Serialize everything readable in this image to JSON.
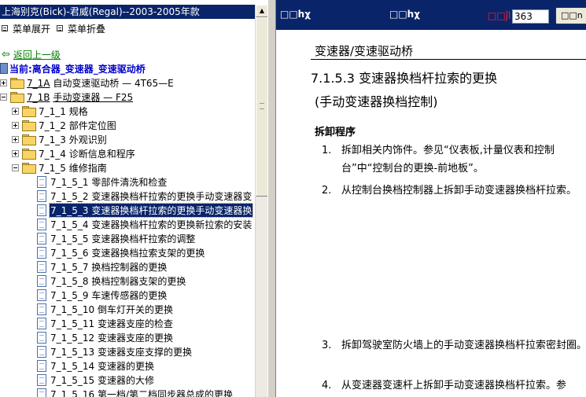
{
  "left": {
    "title": "上海别克(Bick)-君威(Regal)--2003-2005年款",
    "menu_expand": "菜单展开",
    "menu_collapse": "菜单折叠",
    "back_link": "返回上一级",
    "current": "当前:离合器_变速器_变速驱动桥",
    "tree": [
      {
        "code": "7_1A",
        "text": "自动变速驱动桥 — 4T65—E"
      },
      {
        "code": "7_1B",
        "text": "手动变速器 — F25"
      },
      {
        "code": "7_1_1",
        "text": "规格"
      },
      {
        "code": "7_1_2",
        "text": "部件定位图"
      },
      {
        "code": "7_1_3",
        "text": "外观识别"
      },
      {
        "code": "7_1_4",
        "text": "诊断信息和程序"
      },
      {
        "code": "7_1_5",
        "text": "维修指南"
      },
      {
        "code": "7_1_5_1",
        "text": "零部件清洗和检查"
      },
      {
        "code": "7_1_5_2",
        "text": "变速器换档杆拉索的更换手动变速器变"
      },
      {
        "code": "7_1_5_3",
        "text": "变速器换档杆拉索的更换手动变速器换"
      },
      {
        "code": "7_1_5_4",
        "text": "变速器换档杆拉索的更换新拉索的安装"
      },
      {
        "code": "7_1_5_5",
        "text": "变速器换档杆拉索的调整"
      },
      {
        "code": "7_1_5_6",
        "text": "变速器换档拉索支架的更换"
      },
      {
        "code": "7_1_5_7",
        "text": "换档控制器的更换"
      },
      {
        "code": "7_1_5_8",
        "text": "换档控制器支架的更换"
      },
      {
        "code": "7_1_5_9",
        "text": "车速传感器的更换"
      },
      {
        "code": "7_1_5_10",
        "text": "倒车灯开关的更换"
      },
      {
        "code": "7_1_5_11",
        "text": "变速器支座的检查"
      },
      {
        "code": "7_1_5_12",
        "text": "变速器支座的更换"
      },
      {
        "code": "7_1_5_13",
        "text": "变速器支座支撑的更换"
      },
      {
        "code": "7_1_5_14",
        "text": "变速器的更换"
      },
      {
        "code": "7_1_5_15",
        "text": "变速器的大修"
      },
      {
        "code": "7_1_5_16",
        "text": "第一档/第二档同步器总成的更换"
      }
    ]
  },
  "toolbar": {
    "left_text": "□□hχ",
    "mid_text": "□□hχ",
    "label": "□□ĵl",
    "input_value": "363",
    "button": "□□n"
  },
  "doc": {
    "heading": "变速器/变速驱动桥",
    "title": "7.1.5.3 变速器换档杆拉索的更换",
    "subtitle": "(手动变速器换档控制)",
    "section": "拆卸程序",
    "steps": [
      {
        "num": "1.",
        "text": "拆卸相关内饰件。参见“仪表板,计量仪表和控制台”中“控制台的更换-前地板”。"
      },
      {
        "num": "2.",
        "text": "从控制台换档控制器上拆卸手动变速器换档杆拉索。"
      },
      {
        "num": "3.",
        "text": "拆卸驾驶室防火墙上的手动变速器换档杆拉索密封圈。"
      },
      {
        "num": "4.",
        "text": "从变速器变速杆上拆卸手动变速器换档杆拉索。参"
      }
    ]
  }
}
